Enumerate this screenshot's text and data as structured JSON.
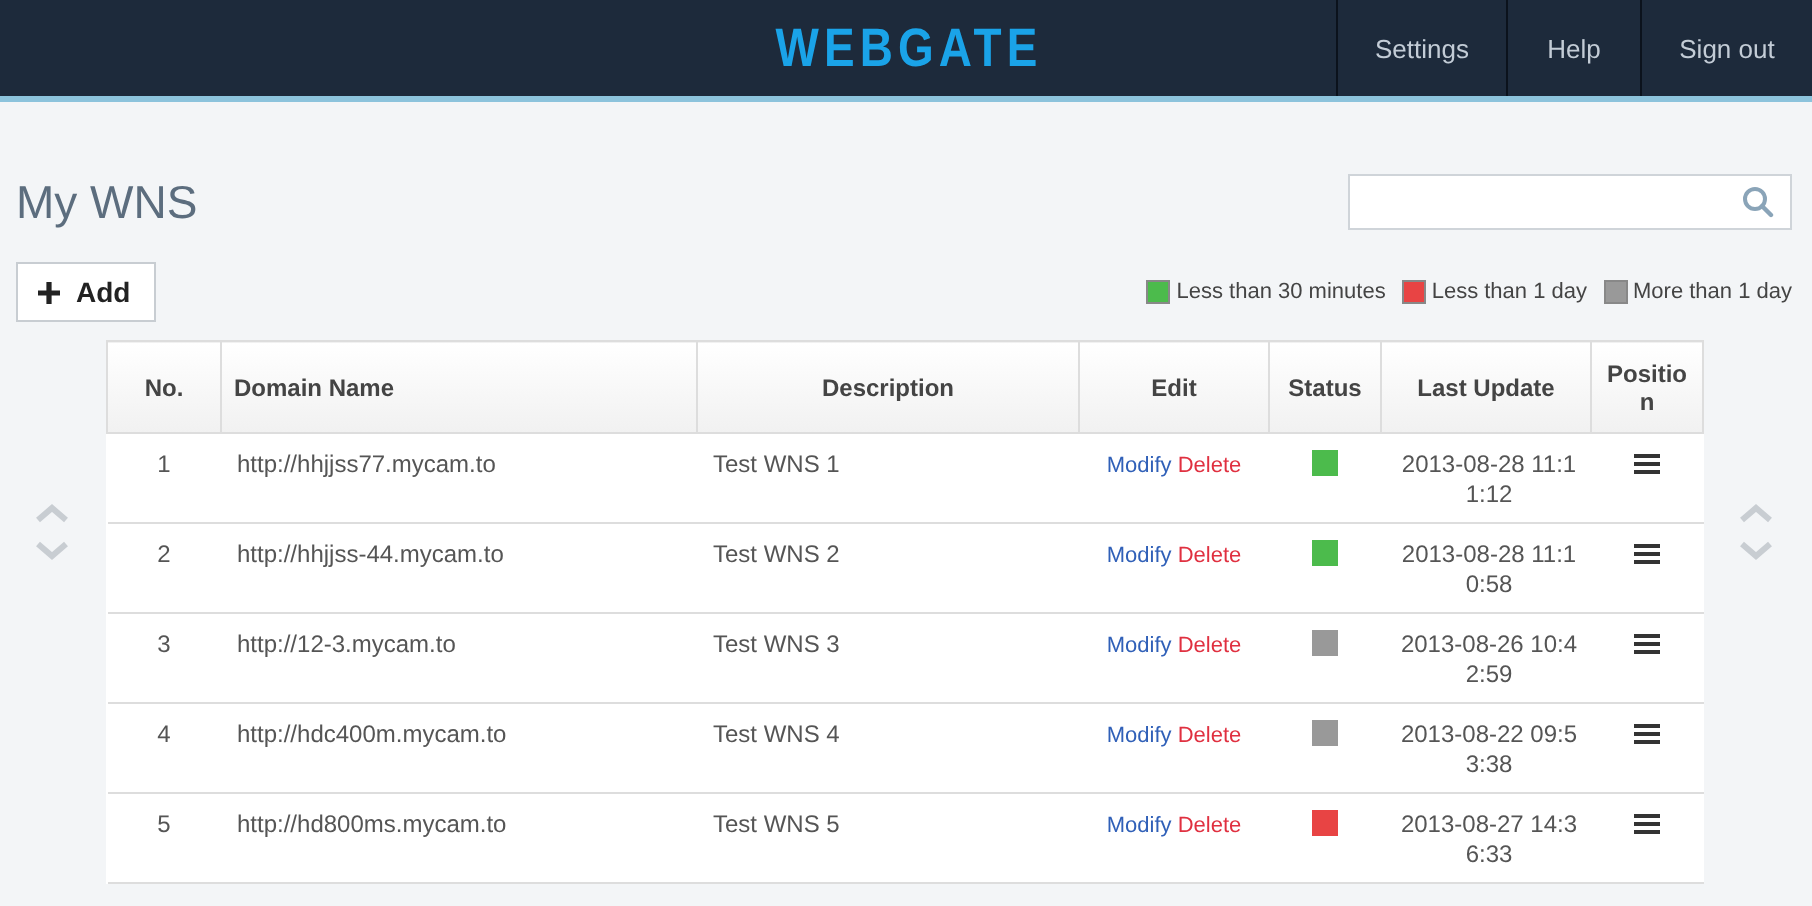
{
  "header": {
    "logo": "WEBGATE",
    "nav": [
      "Settings",
      "Help",
      "Sign out"
    ]
  },
  "page_title": "My WNS",
  "add_button": "Add",
  "legend": [
    {
      "label": "Less than 30 minutes",
      "color": "#4cbb4c"
    },
    {
      "label": "Less than 1 day",
      "color": "#e84444"
    },
    {
      "label": "More than 1 day",
      "color": "#999999"
    }
  ],
  "table": {
    "columns": [
      "No.",
      "Domain Name",
      "Description",
      "Edit",
      "Status",
      "Last Update",
      "Position"
    ],
    "rows": [
      {
        "no": "1",
        "domain": "http://hhjjss77.mycam.to",
        "description": "Test WNS 1",
        "modify": "Modify",
        "delete": "Delete",
        "color": "#4cbb4c",
        "last_update": "2013-08-28 11:11:12"
      },
      {
        "no": "2",
        "domain": "http://hhjjss-44.mycam.to",
        "description": "Test WNS 2",
        "modify": "Modify",
        "delete": "Delete",
        "color": "#4cbb4c",
        "last_update": "2013-08-28 11:10:58"
      },
      {
        "no": "3",
        "domain": "http://12-3.mycam.to",
        "description": "Test WNS 3",
        "modify": "Modify",
        "delete": "Delete",
        "color": "#999999",
        "last_update": "2013-08-26 10:42:59"
      },
      {
        "no": "4",
        "domain": "http://hdc400m.mycam.to",
        "description": "Test WNS 4",
        "modify": "Modify",
        "delete": "Delete",
        "color": "#999999",
        "last_update": "2013-08-22 09:53:38"
      },
      {
        "no": "5",
        "domain": "http://hd800ms.mycam.to",
        "description": "Test WNS 5",
        "modify": "Modify",
        "delete": "Delete",
        "color": "#e84444",
        "last_update": "2013-08-27 14:36:33"
      }
    ]
  }
}
